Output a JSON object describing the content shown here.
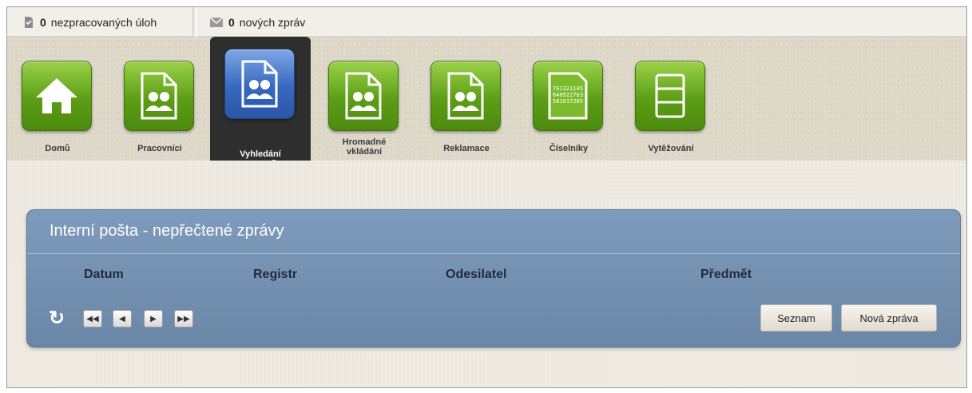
{
  "topbar": {
    "tasks": {
      "count": "0",
      "label": "nezpracovaných úloh",
      "icon": "tasks-icon"
    },
    "messages": {
      "count": "0",
      "label": "nových zpráv",
      "icon": "envelope-icon"
    }
  },
  "nav": {
    "items": [
      {
        "label": "Domů",
        "icon": "home-icon",
        "active": false
      },
      {
        "label": "Pracovníci",
        "icon": "users-document-icon",
        "active": false
      },
      {
        "label": "Vyhledání\npracovníka",
        "icon": "users-document-icon",
        "active": true
      },
      {
        "label": "Hromadné\nvkládání",
        "icon": "users-document-icon",
        "active": false
      },
      {
        "label": "Reklamace",
        "icon": "users-document-icon",
        "active": false
      },
      {
        "label": "Číselníky",
        "icon": "numbers-document-icon",
        "active": false
      },
      {
        "label": "Vytěžování",
        "icon": "list-document-icon",
        "active": false
      }
    ],
    "numbers_icon_text": [
      "761321145",
      "640922763",
      "581017285"
    ]
  },
  "panel": {
    "title": "Interní pošta - nepřečtené zprávy",
    "columns": [
      "Datum",
      "Registr",
      "Odesilatel",
      "Předmět"
    ],
    "buttons": {
      "list": "Seznam",
      "new_message": "Nová zpráva"
    },
    "pager_icons": [
      "first-page-icon",
      "prev-page-icon",
      "next-page-icon",
      "last-page-icon"
    ]
  },
  "colors": {
    "green_tile": "#5c9e16",
    "blue_tile_active": "#3768bf",
    "panel_bg": "#7690b1",
    "active_nav_bg": "#2e2e2e"
  }
}
